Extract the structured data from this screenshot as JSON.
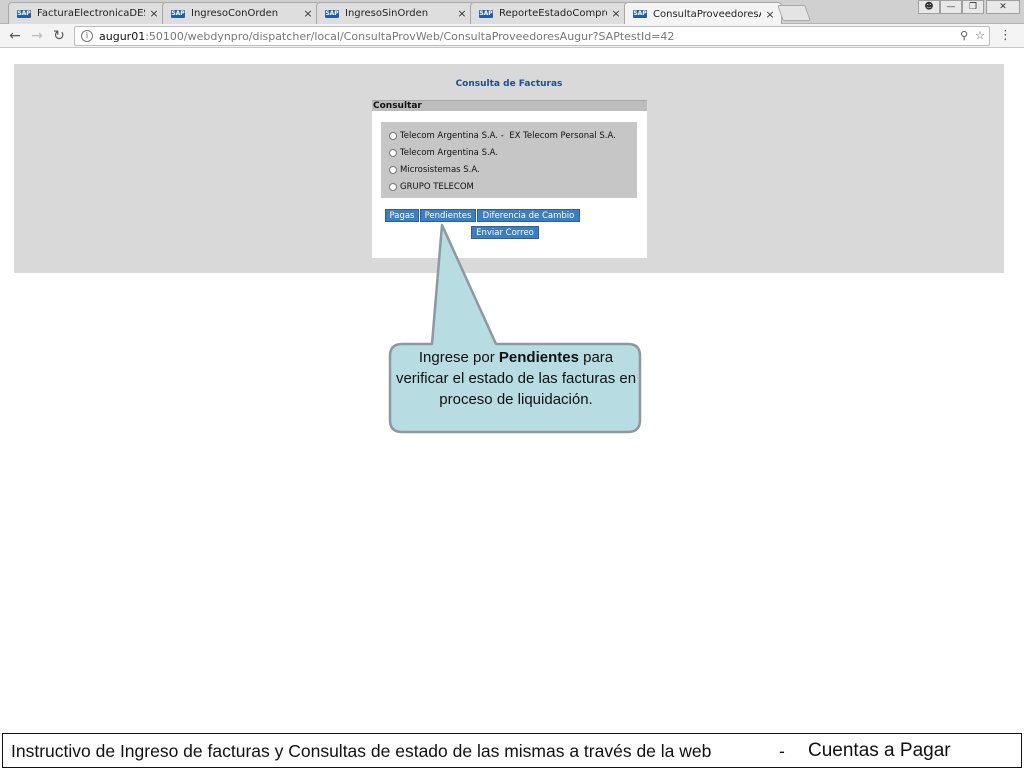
{
  "browser": {
    "tabs": [
      {
        "title": "FacturaElectronicaDES_Q",
        "favicon": "SAP",
        "active": false
      },
      {
        "title": "IngresoConOrden",
        "favicon": "SAP",
        "active": false
      },
      {
        "title": "IngresoSinOrden",
        "favicon": "SAP",
        "active": false
      },
      {
        "title": "ReporteEstadoComproba",
        "favicon": "SAP",
        "active": false
      },
      {
        "title": "ConsultaProveedoresAug",
        "favicon": "SAP",
        "active": true
      }
    ],
    "tab_close_glyph": "×",
    "url_host": "augur01",
    "url_rest": ":50100/webdynpro/dispatcher/local/ConsultaProvWeb/ConsultaProveedoresAugur?SAPtestId=42",
    "icons": [
      "back-icon",
      "forward-icon",
      "reload-icon",
      "info-icon",
      "pin-icon",
      "star-icon",
      "menu-icon"
    ]
  },
  "page": {
    "title": "Consulta de Facturas",
    "section_header": "Consultar",
    "radio_options": [
      "Telecom Argentina S.A. -  EX Telecom Personal S.A.",
      "Telecom Argentina S.A.",
      "Microsistemas S.A.",
      "GRUPO TELECOM"
    ],
    "buttons": {
      "pagas": "Pagas",
      "pendientes": "Pendientes",
      "diferencia": "Diferencia de Cambio",
      "enviar": "Enviar Correo"
    }
  },
  "callout": {
    "prefix": "Ingrese por ",
    "bold": "Pendientes",
    "suffix": " para verificar el estado de las facturas en proceso de liquidación."
  },
  "footer": {
    "main": "Instructivo de Ingreso de facturas y Consultas de estado de las mismas a través de la web",
    "separator": "-",
    "section": "Cuentas a Pagar"
  },
  "colors": {
    "sap_button": "#3b7fc0",
    "callout_fill": "#b7dde3",
    "callout_border": "#8c9aa0",
    "panel_bg": "#d9d9d9",
    "title_blue": "#1d4f8a"
  }
}
